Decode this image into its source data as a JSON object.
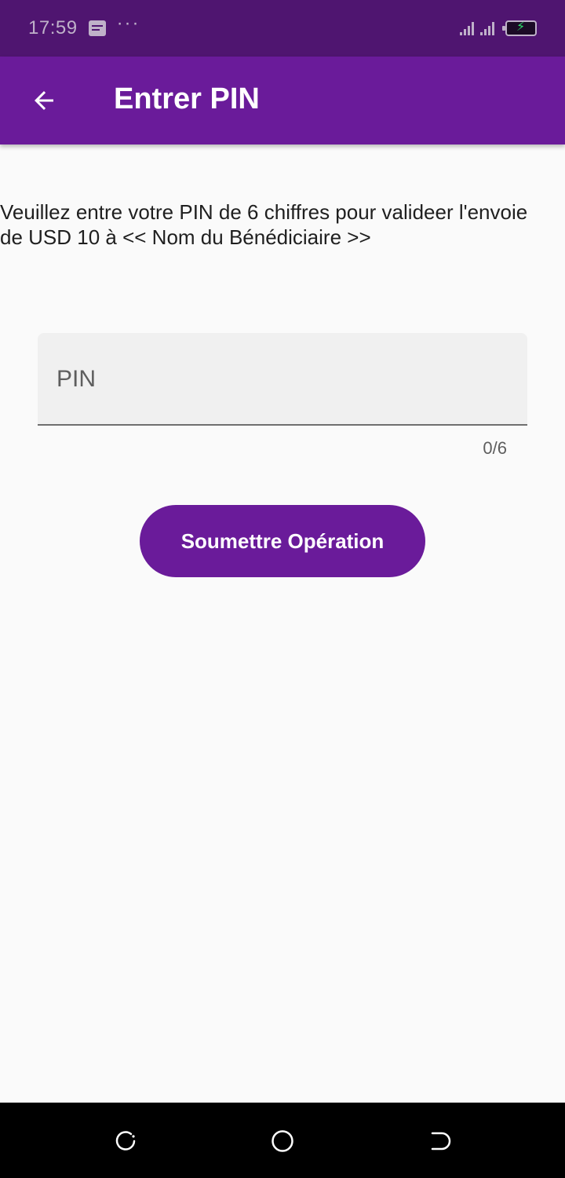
{
  "status_bar": {
    "time": "17:59",
    "more_indicator": "···",
    "icons": [
      "message-icon",
      "signal-icon",
      "signal-icon",
      "battery-charging-icon"
    ]
  },
  "app_bar": {
    "title": "Entrer PIN",
    "back_icon": "arrow-back-icon",
    "color": "#6a1b9a"
  },
  "instruction": {
    "text": "Veuillez entre votre PIN de 6 chiffres pour valideer l'envoie\nde USD 10 à << Nom du Bénédiciaire >>"
  },
  "pin_field": {
    "placeholder": "PIN",
    "value": "",
    "counter": "0/6"
  },
  "submit": {
    "label": "Soumettre Opération"
  },
  "nav_bar": {
    "icons": [
      "recent-apps-icon",
      "home-icon",
      "back-nav-icon"
    ]
  }
}
